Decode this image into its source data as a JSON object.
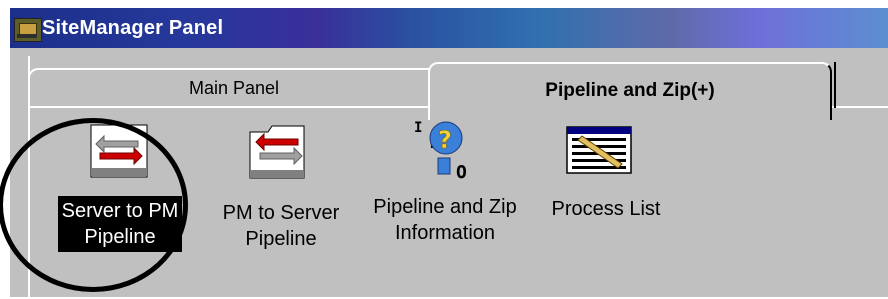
{
  "window": {
    "title": "SiteManager Panel"
  },
  "tabs": [
    {
      "label": "Main Panel",
      "selected": false
    },
    {
      "label": "Pipeline and Zip(+)",
      "selected": true
    }
  ],
  "tools": [
    {
      "label_line1": "Server to PM",
      "label_line2": "Pipeline",
      "icon": "server-to-pm-icon",
      "selected": true
    },
    {
      "label_line1": "PM to Server",
      "label_line2": "Pipeline",
      "icon": "pm-to-server-icon",
      "selected": false
    },
    {
      "label_line1": "Pipeline and Zip",
      "label_line2": "Information",
      "icon": "info-icon",
      "selected": false
    },
    {
      "label_line1": "Process List",
      "label_line2": "",
      "icon": "process-list-icon",
      "selected": false
    }
  ],
  "colors": {
    "window_bg": "#c0c0c0",
    "selection_bg": "#000000",
    "arrow_red": "#cc0000",
    "arrow_gray": "#a0a0a0"
  }
}
